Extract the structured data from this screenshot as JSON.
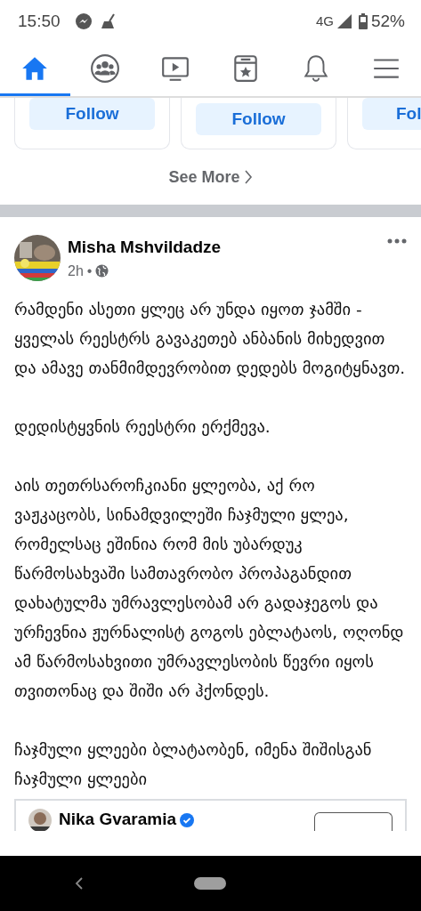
{
  "status_bar": {
    "time": "15:50",
    "network": "4G",
    "battery": "52%"
  },
  "tabs": [
    {
      "selected": true
    },
    {
      "selected": false
    },
    {
      "selected": false
    },
    {
      "selected": false
    },
    {
      "selected": false
    },
    {
      "selected": false
    }
  ],
  "suggestions": {
    "follow_buttons": [
      "Follow",
      "Follow",
      "Fol"
    ],
    "see_more": "See More"
  },
  "post": {
    "author": "Misha Mshvildadze",
    "time": "2h",
    "separator": "•",
    "paragraphs": [
      "რამდენი ასეთი ყლეც არ უნდა იყოთ ჯამში - ყველას რეესტრს გავაკეთებ ანბანის მიხედვით და ამავე თანმიმდევრობით დედებს მოგიტყნავთ.",
      "დედისტყვნის რეესტრი ერქმევა.",
      "აის თეთრსაროჩკიანი ყლეობა, აქ რო ვაჟკაცობს, სინამდვილეში ჩაჯმული ყლეა, რომელსაც ეშინია რომ მის უბარდუკ წარმოსახვაში სამთავრობო პროპაგანდით დახატულმა უმრავლესობამ არ გადაჯეგოს და ურჩევნია ჟურნალისტ გოგოს ებლატაოს, ოღონდ ამ წარმოსახვითი უმრავლესობის წევრი იყოს თვითონაც და შიში არ ჰქონდეს.",
      "ჩაჯმული ყლეები ბლატაობენ, იმენა შიშისგან ჩაჯმული ყლეები"
    ],
    "shared": {
      "author": "Nika Gvaramia",
      "verified": true
    }
  }
}
